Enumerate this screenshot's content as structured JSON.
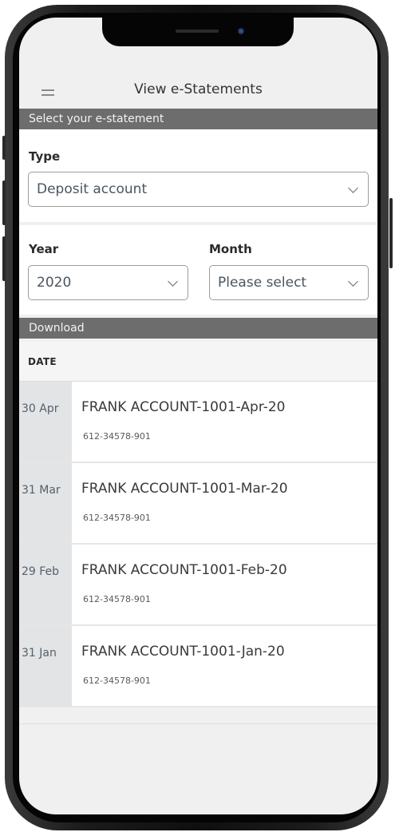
{
  "header": {
    "title": "View e-Statements",
    "menu_icon": "hamburger-menu-icon"
  },
  "select_section": {
    "heading": "Select your e-statement"
  },
  "type_field": {
    "label": "Type",
    "value": "Deposit account"
  },
  "year_field": {
    "label": "Year",
    "value": "2020"
  },
  "month_field": {
    "label": "Month",
    "value": "Please select"
  },
  "download_section": {
    "heading": "Download"
  },
  "table": {
    "column_date": "DATE",
    "rows": [
      {
        "date": "30 Apr",
        "title": "FRANK ACCOUNT-1001-Apr-20",
        "account": "612-34578-901"
      },
      {
        "date": "31 Mar",
        "title": "FRANK ACCOUNT-1001-Mar-20",
        "account": "612-34578-901"
      },
      {
        "date": "29 Feb",
        "title": "FRANK ACCOUNT-1001-Feb-20",
        "account": "612-34578-901"
      },
      {
        "date": "31 Jan",
        "title": "FRANK ACCOUNT-1001-Jan-20",
        "account": "612-34578-901"
      }
    ]
  },
  "colors": {
    "section_bar": "#6d6d6d",
    "screen_bg": "#f0f0f0",
    "date_cell_bg": "#e2e4e6"
  }
}
